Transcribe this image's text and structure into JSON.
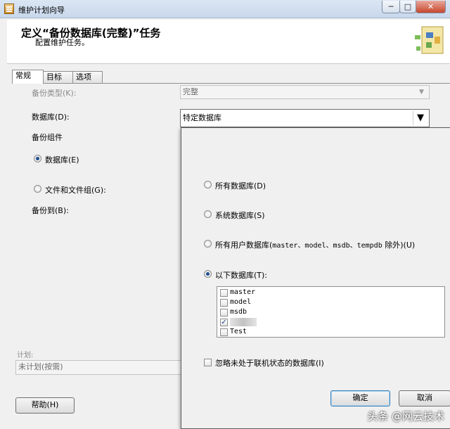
{
  "window": {
    "title": "维护计划向导",
    "minimize": "─",
    "maximize": "□",
    "close": "✕"
  },
  "header": {
    "title": "定义“备份数据库(完整)”任务",
    "subtitle": "配置维护任务。",
    "icon": "wizard-icon"
  },
  "tabs": [
    {
      "label": "常规",
      "active": true
    },
    {
      "label": "目标",
      "active": false
    },
    {
      "label": "选项",
      "active": false
    }
  ],
  "general": {
    "backup_type_label": "备份类型(K):",
    "backup_type_value": "完整",
    "database_label": "数据库(D):",
    "database_value": "特定数据库",
    "backup_component_label": "备份组件",
    "radio_database_label": "数据库(E)",
    "radio_files_label": "文件和文件组(G):",
    "backup_to_label": "备份到(B):",
    "schedule_label": "计划:",
    "schedule_value": "未计划(按需)"
  },
  "footer": {
    "help_label": "帮助(H)"
  },
  "popup": {
    "opt_all": "所有数据库(D)",
    "opt_system": "系统数据库(S)",
    "opt_user_prefix": "所有用户数据库(",
    "opt_user_mono": "master、model、msdb、tempdb",
    "opt_user_suffix": " 除外)(U)",
    "opt_these": "以下数据库(T):",
    "databases": [
      {
        "name": "master",
        "checked": false
      },
      {
        "name": "model",
        "checked": false
      },
      {
        "name": "msdb",
        "checked": false
      },
      {
        "name": "",
        "checked": true
      },
      {
        "name": "Test",
        "checked": false
      }
    ],
    "ignore_offline": "忽略未处于联机状态的数据库(I)",
    "ok_label": "确定",
    "cancel_label": "取消"
  },
  "watermark": "头条 @网云技术",
  "colors": {
    "titlebar": "#c8d8ec",
    "close": "#c7452c",
    "accent": "#3c7fb1"
  }
}
